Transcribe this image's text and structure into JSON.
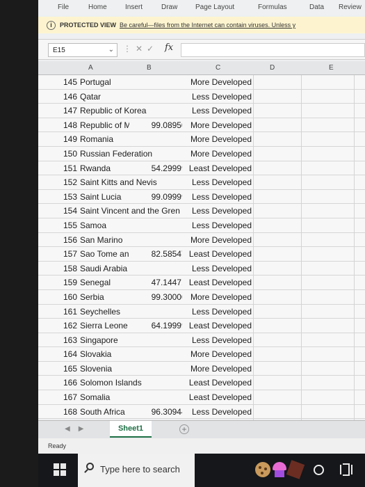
{
  "ribbon": {
    "tabs": [
      "File",
      "Home",
      "Insert",
      "Draw",
      "Page Layout",
      "Formulas",
      "Data",
      "Review"
    ]
  },
  "protected_view": {
    "label": "PROTECTED VIEW",
    "message": "Be careful—files from the Internet can contain viruses. Unless y"
  },
  "formula_bar": {
    "name_box": "E15",
    "fx": "fx",
    "formula": ""
  },
  "columns": [
    "A",
    "B",
    "C",
    "D",
    "E"
  ],
  "rows": [
    {
      "num": "145",
      "name": "Portugal",
      "b": "",
      "c": "More Developed"
    },
    {
      "num": "146",
      "name": "Qatar",
      "b": "",
      "c": "Less Developed"
    },
    {
      "num": "147",
      "name": "Republic of Korea",
      "b": "",
      "c": "Less Developed"
    },
    {
      "num": "148",
      "name": "Republic of M",
      "b": "99.0895004",
      "c": "More Developed"
    },
    {
      "num": "149",
      "name": "Romania",
      "b": "",
      "c": "More Developed"
    },
    {
      "num": "150",
      "name": "Russian Federation",
      "b": "",
      "c": "More Developed"
    },
    {
      "num": "151",
      "name": "Rwanda",
      "b": "54.2999992",
      "c": "Least Developed"
    },
    {
      "num": "152",
      "name": "Saint Kitts and Nevis",
      "b": "",
      "c": "Less Developed"
    },
    {
      "num": "153",
      "name": "Saint Lucia",
      "b": "99.0999985",
      "c": "Less Developed"
    },
    {
      "num": "154",
      "name": "Saint Vincent and the Gren",
      "b": "",
      "c": "Less Developed"
    },
    {
      "num": "155",
      "name": "Samoa",
      "b": "",
      "c": "Less Developed"
    },
    {
      "num": "156",
      "name": "San Marino",
      "b": "",
      "c": "More Developed"
    },
    {
      "num": "157",
      "name": "Sao Tome an",
      "b": "82.5854797",
      "c": "Least Developed"
    },
    {
      "num": "158",
      "name": "Saudi Arabia",
      "b": "",
      "c": "Less Developed"
    },
    {
      "num": "159",
      "name": "Senegal",
      "b": "47.1447144",
      "c": "Least Developed"
    },
    {
      "num": "160",
      "name": "Serbia",
      "b": "99.3000031",
      "c": "More Developed"
    },
    {
      "num": "161",
      "name": "Seychelles",
      "b": "",
      "c": "Less Developed"
    },
    {
      "num": "162",
      "name": "Sierra Leone",
      "b": "64.1999969",
      "c": "Least Developed"
    },
    {
      "num": "163",
      "name": "Singapore",
      "b": "",
      "c": "Less Developed"
    },
    {
      "num": "164",
      "name": "Slovakia",
      "b": "",
      "c": "More Developed"
    },
    {
      "num": "165",
      "name": "Slovenia",
      "b": "",
      "c": "More Developed"
    },
    {
      "num": "166",
      "name": "Solomon Islands",
      "b": "",
      "c": "Least Developed"
    },
    {
      "num": "167",
      "name": "Somalia",
      "b": "",
      "c": "Least Developed"
    },
    {
      "num": "168",
      "name": "South Africa",
      "b": "96.3094482",
      "c": "Less Developed"
    }
  ],
  "sheet_tabs": {
    "active": "Sheet1",
    "add": "+"
  },
  "status": {
    "text": "Ready"
  },
  "taskbar": {
    "search_placeholder": "Type here to search"
  }
}
